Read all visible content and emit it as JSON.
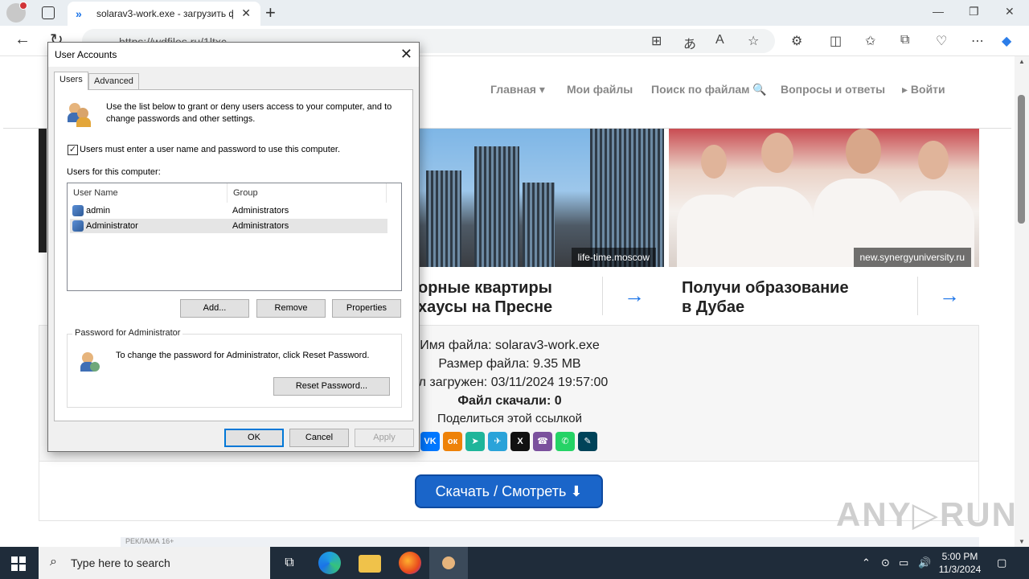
{
  "browser": {
    "tab_title": "solarav3-work.exe - загрузить ф",
    "url": "https://wdfiles.ru/1ltxc"
  },
  "site": {
    "nav": [
      "Главная ▾",
      "Мои файлы",
      "Поиск по файлам 🔍",
      "Вопросы и ответы",
      "▸ Войти"
    ],
    "ad1": {
      "credit": "life-time.moscow",
      "line1": "орные квартиры",
      "line2": "хаусы на Пресне"
    },
    "ad2": {
      "credit": "new.synergyuniversity.ru",
      "line1": "Получи образование",
      "line2": "в Дубае"
    },
    "file": {
      "name": "Имя файла: solarav3-work.exe",
      "size": "Размер файла: 9.35 MB",
      "uploaded": "йл загружен: 03/11/2024 19:57:00",
      "downloads": "Файл скачали: 0",
      "share": "Поделиться этой ссылкой"
    },
    "share_buttons": [
      {
        "name": "vk",
        "glyph": "VK",
        "color": "#0077ff"
      },
      {
        "name": "ok",
        "glyph": "ок",
        "color": "#ee8208"
      },
      {
        "name": "yandex-messenger",
        "glyph": "➤",
        "color": "#1fb59a"
      },
      {
        "name": "telegram",
        "glyph": "✈",
        "color": "#2aa3d9"
      },
      {
        "name": "x",
        "glyph": "X",
        "color": "#111111"
      },
      {
        "name": "viber",
        "glyph": "☎",
        "color": "#7b519d"
      },
      {
        "name": "whatsapp",
        "glyph": "✆",
        "color": "#25d366"
      },
      {
        "name": "livejournal",
        "glyph": "✎",
        "color": "#004359"
      }
    ],
    "download_button": "Скачать / Смотреть ⬇",
    "ad_label": "РЕКЛАМА 16+",
    "watermark": "ANY▷RUN"
  },
  "dialog": {
    "title": "User Accounts",
    "tabs": [
      "Users",
      "Advanced"
    ],
    "intro": "Use the list below to grant or deny users access to your computer, and to change passwords and other settings.",
    "checkbox_label": "Users must enter a user name and password to use this computer.",
    "checkbox_checked": true,
    "list_label": "Users for this computer:",
    "columns": [
      "User Name",
      "Group"
    ],
    "users": [
      {
        "name": "admin",
        "group": "Administrators"
      },
      {
        "name": "Administrator",
        "group": "Administrators"
      }
    ],
    "buttons": {
      "add": "Add...",
      "remove": "Remove",
      "properties": "Properties"
    },
    "password_group": "Password for Administrator",
    "password_text": "To change the password for Administrator, click Reset Password.",
    "reset_button": "Reset Password...",
    "ok": "OK",
    "cancel": "Cancel",
    "apply": "Apply"
  },
  "taskbar": {
    "search_placeholder": "Type here to search",
    "time": "5:00 PM",
    "date": "11/3/2024"
  }
}
